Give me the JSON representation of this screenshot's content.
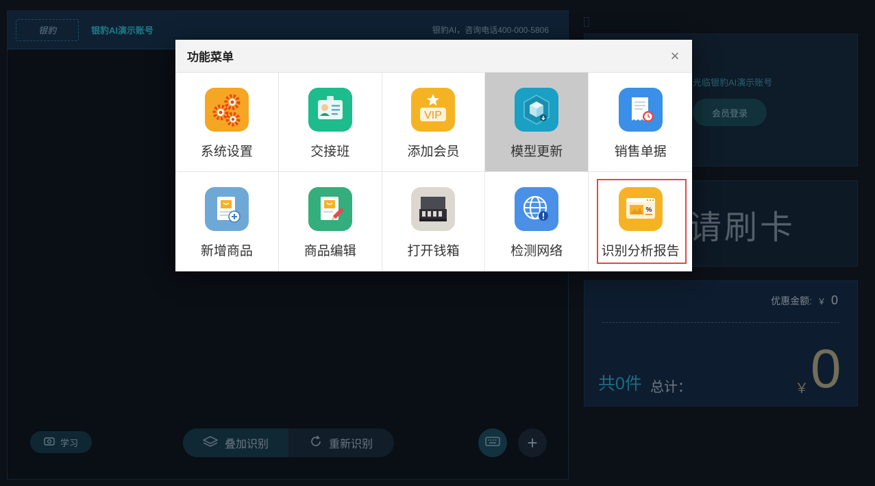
{
  "header": {
    "logo_text": "银豹",
    "account_name": "银豹AI演示账号",
    "consult_info": "银豹AI，咨询电话400-000-5806"
  },
  "bottom_bar": {
    "study_label": "学习",
    "stack_recognize_label": "叠加识别",
    "re_recognize_label": "重新识别"
  },
  "right_panel": {
    "welcome_text": "光临银豹AI演示账号",
    "member_login_label": "会员登录",
    "swipe_prompt": "请刷卡",
    "discount_label": "优惠金额:",
    "discount_currency": "￥",
    "discount_value": "0",
    "item_count": "共0件",
    "total_label": "总计：",
    "total_currency": "￥",
    "total_value": "0"
  },
  "modal": {
    "title": "功能菜单",
    "close_glyph": "×",
    "items": [
      {
        "label": "系统设置",
        "icon": "gears-icon",
        "color": "#f5a623"
      },
      {
        "label": "交接班",
        "icon": "id-badge-icon",
        "color": "#1cbc8c"
      },
      {
        "label": "添加会员",
        "icon": "vip-icon",
        "color": "#f5b324"
      },
      {
        "label": "模型更新",
        "icon": "model-cube-icon",
        "color": "#1aa0c4"
      },
      {
        "label": "销售单据",
        "icon": "receipt-icon",
        "color": "#3a8fe8"
      },
      {
        "label": "新增商品",
        "icon": "add-product-icon",
        "color": "#6ea8d6"
      },
      {
        "label": "商品编辑",
        "icon": "edit-product-icon",
        "color": "#34ae7c"
      },
      {
        "label": "打开钱箱",
        "icon": "cash-drawer-icon",
        "color": "#dcd8d0"
      },
      {
        "label": "检测网络",
        "icon": "globe-alert-icon",
        "color": "#4a90e8"
      },
      {
        "label": "识别分析报告",
        "icon": "report-icon",
        "color": "#f5b324"
      }
    ]
  }
}
